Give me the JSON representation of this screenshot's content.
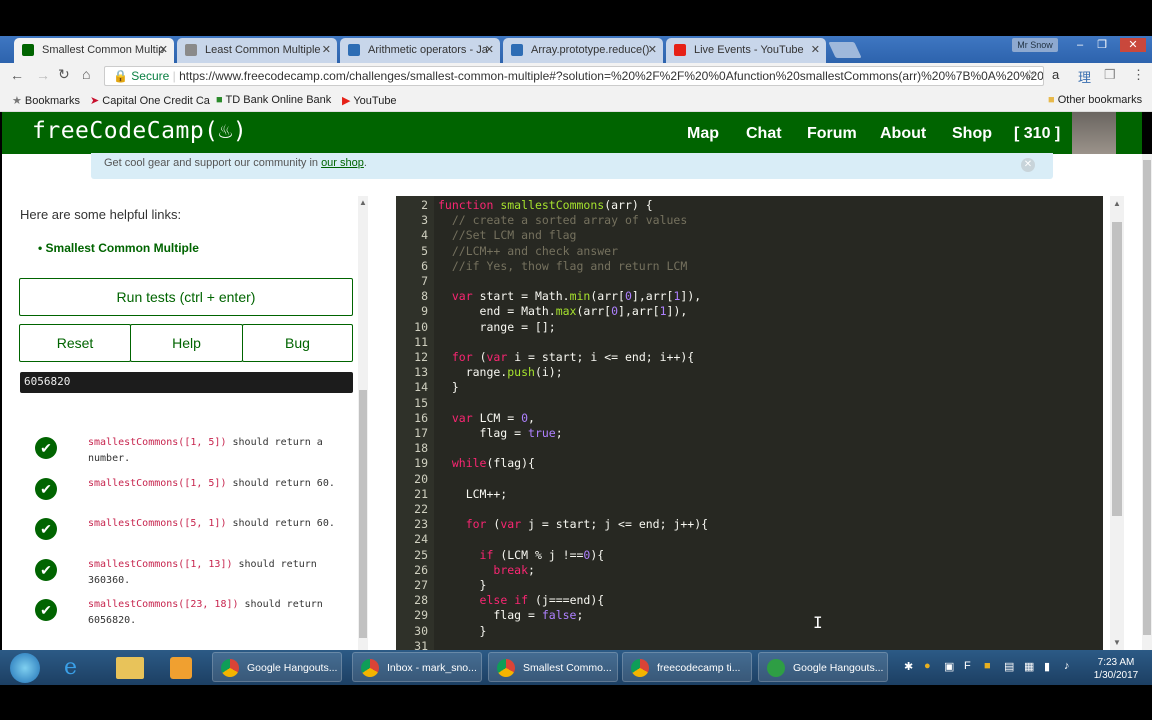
{
  "browser": {
    "tabs": [
      {
        "label": "Smallest Common Multip",
        "active": true,
        "favicon_color": "#006400"
      },
      {
        "label": "Least Common Multiple",
        "active": false,
        "favicon_color": "#8a8a8a"
      },
      {
        "label": "Arithmetic operators - Ja",
        "active": false,
        "favicon_color": "#2e6db4"
      },
      {
        "label": "Array.prototype.reduce()",
        "active": false,
        "favicon_color": "#2e6db4"
      },
      {
        "label": "Live Events - YouTube",
        "active": false,
        "favicon_color": "#e62117"
      }
    ],
    "profile_label": "Mr Snow",
    "secure_label": "Secure",
    "url": "https://www.freecodecamp.com/challenges/smallest-common-multiple#?solution=%20%2F%2F%20%0Afunction%20smallestCommons(arr)%20%7B%0A%20%20",
    "bookmarks": [
      "Bookmarks",
      "Capital One Credit Ca",
      "TD Bank Online Bank",
      "YouTube"
    ],
    "other_bookmarks": "Other bookmarks"
  },
  "site": {
    "logo": "freeCodeCamp(♨)",
    "nav": [
      "Map",
      "Chat",
      "Forum",
      "About",
      "Shop",
      "[ 310 ]"
    ],
    "banner_text": "Get cool gear and support our community in ",
    "banner_link": "our shop",
    "banner_suffix": "."
  },
  "challenge": {
    "helpful_links_title": "Here are some helpful links:",
    "links": [
      "Smallest Common Multiple"
    ],
    "run_button": "Run tests (ctrl + enter)",
    "reset_button": "Reset",
    "help_button": "Help",
    "bug_button": "Bug",
    "output": "6056820",
    "tests": [
      {
        "code": "smallestCommons([1, 5])",
        "text": " should return a number."
      },
      {
        "code": "smallestCommons([1, 5])",
        "text": " should return 60."
      },
      {
        "code": "smallestCommons([5, 1])",
        "text": " should return 60."
      },
      {
        "code": "smallestCommons([1, 13])",
        "text": " should return 360360."
      },
      {
        "code": "smallestCommons([23, 18])",
        "text": " should return 6056820."
      }
    ]
  },
  "editor": {
    "line_numbers": [
      "2",
      "3",
      "4",
      "5",
      "6",
      "7",
      "8",
      "9",
      "10",
      "11",
      "12",
      "13",
      "14",
      "15",
      "16",
      "17",
      "18",
      "19",
      "20",
      "21",
      "22",
      "23",
      "24",
      "25",
      "26",
      "27",
      "28",
      "29",
      "30",
      "31"
    ],
    "lines": [
      "function smallestCommons(arr) {",
      "  // create a sorted array of values",
      "  //Set LCM and flag",
      "  //LCM++ and check answer",
      "  //if Yes, thow flag and return LCM",
      "",
      "  var start = Math.min(arr[0],arr[1]),",
      "      end = Math.max(arr[0],arr[1]),",
      "      range = [];",
      "",
      "  for (var i = start; i <= end; i++){",
      "    range.push(i);",
      "  }",
      "",
      "  var LCM = 0,",
      "      flag = true;",
      "",
      "  while(flag){",
      "",
      "    LCM++;",
      "",
      "    for (var j = start; j <= end; j++){",
      "",
      "      if (LCM % j !==0){",
      "        break;",
      "      }",
      "      else if (j===end){",
      "        flag = false;",
      "      }",
      ""
    ]
  },
  "taskbar": {
    "items": [
      {
        "label": "Google Hangouts...",
        "color": "#e8a020"
      },
      {
        "label": "Inbox - mark_sno...",
        "color": "#e8a020"
      },
      {
        "label": "Smallest Commo...",
        "color": "#e8a020"
      },
      {
        "label": "freecodecamp ti...",
        "color": "#e8a020"
      },
      {
        "label": "Google Hangouts...",
        "color": "#2e9e44"
      }
    ],
    "time": "7:23 AM",
    "date": "1/30/2017"
  }
}
